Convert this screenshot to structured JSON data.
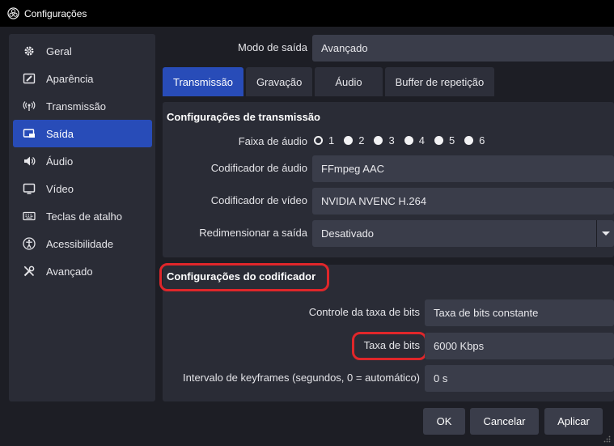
{
  "window": {
    "title": "Configurações"
  },
  "sidebar": {
    "items": [
      {
        "label": "Geral",
        "icon": "gear-icon"
      },
      {
        "label": "Aparência",
        "icon": "appearance-icon"
      },
      {
        "label": "Transmissão",
        "icon": "broadcast-icon"
      },
      {
        "label": "Saída",
        "icon": "output-icon",
        "active": true
      },
      {
        "label": "Áudio",
        "icon": "speaker-icon"
      },
      {
        "label": "Vídeo",
        "icon": "monitor-icon"
      },
      {
        "label": "Teclas de atalho",
        "icon": "keyboard-icon"
      },
      {
        "label": "Acessibilidade",
        "icon": "accessibility-icon"
      },
      {
        "label": "Avançado",
        "icon": "tools-icon"
      }
    ]
  },
  "output_mode": {
    "label": "Modo de saída",
    "value": "Avançado"
  },
  "tabs": [
    {
      "label": "Transmissão",
      "active": true
    },
    {
      "label": "Gravação"
    },
    {
      "label": "Áudio"
    },
    {
      "label": "Buffer de repetição"
    }
  ],
  "stream_settings": {
    "title": "Configurações de transmissão",
    "audio_track": {
      "label": "Faixa de áudio",
      "options": [
        "1",
        "2",
        "3",
        "4",
        "5",
        "6"
      ],
      "selected": "1"
    },
    "audio_encoder": {
      "label": "Codificador de áudio",
      "value": "FFmpeg AAC"
    },
    "video_encoder": {
      "label": "Codificador de vídeo",
      "value": "NVIDIA NVENC H.264"
    },
    "rescale": {
      "label": "Redimensionar a saída",
      "value": "Desativado"
    }
  },
  "encoder_settings": {
    "title": "Configurações do codificador",
    "rate_control": {
      "label": "Controle da taxa de bits",
      "value": "Taxa de bits constante"
    },
    "bitrate": {
      "label": "Taxa de bits",
      "value": "6000 Kbps"
    },
    "keyframe": {
      "label": "Intervalo de keyframes (segundos, 0 = automático)",
      "value": "0 s"
    }
  },
  "footer": {
    "ok": "OK",
    "cancel": "Cancelar",
    "apply": "Aplicar"
  },
  "colors": {
    "accent": "#284cb8",
    "highlight": "#e0262a",
    "background": "#1d1e25",
    "panel": "#2a2c36",
    "field": "#3a3d4a"
  }
}
